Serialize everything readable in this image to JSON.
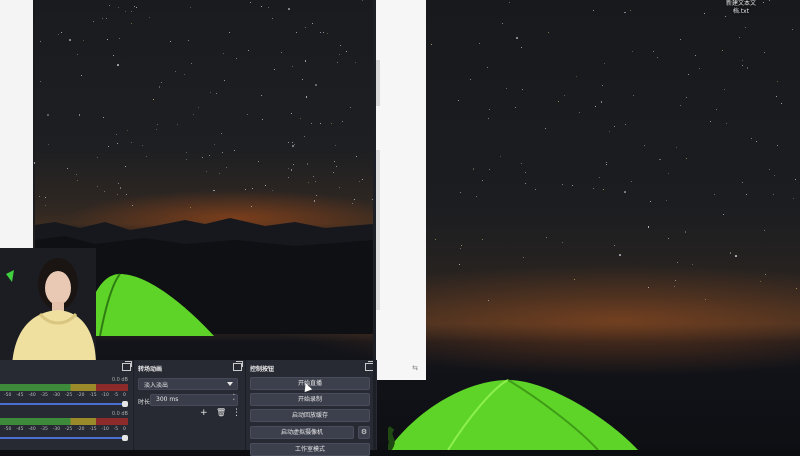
{
  "desktop": {
    "icon_label": "新建文本文档.txt"
  },
  "mixer": {
    "tracks": [
      {
        "db_value": "0.0 dB",
        "ticks": [
          "-50",
          "-45",
          "-40",
          "-35",
          "-30",
          "-25",
          "-20",
          "-15",
          "-10",
          "-5",
          "0"
        ]
      },
      {
        "db_value": "0.0 dB",
        "ticks": [
          "-50",
          "-45",
          "-40",
          "-35",
          "-30",
          "-25",
          "-20",
          "-15",
          "-10",
          "-5",
          "0"
        ]
      }
    ]
  },
  "transitions": {
    "title": "转场动画",
    "selected": "淡入淡出",
    "duration_label": "时长",
    "duration_value": "300 ms",
    "add_icon": "+",
    "delete_icon": "🗑",
    "more_icon": "⋮"
  },
  "controls": {
    "title": "控制按钮",
    "start_stream": "开始直播",
    "start_record": "开始录制",
    "start_replay_buffer": "启动回放缓存",
    "start_virtual_camera": "启动虚拟摄像机",
    "studio_mode": "工作室模式"
  },
  "colors": {
    "dock_bg": "#272a33",
    "button_bg": "#3c404c",
    "tent": "#5fd428",
    "volume_slider": "#4a6fd0"
  }
}
